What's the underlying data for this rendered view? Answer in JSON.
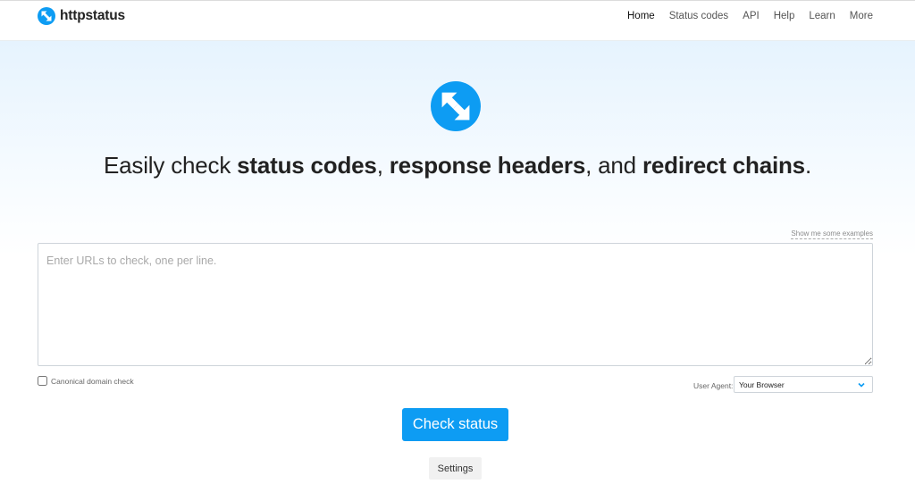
{
  "brand": {
    "name": "httpstatus",
    "logo_icon": "httpstatus-arrows-icon",
    "accent": "#0d9cf3"
  },
  "nav": {
    "items": [
      {
        "label": "Home",
        "active": true
      },
      {
        "label": "Status codes"
      },
      {
        "label": "API"
      },
      {
        "label": "Help"
      },
      {
        "label": "Learn"
      },
      {
        "label": "More"
      }
    ]
  },
  "hero": {
    "headline_prefix": "Easily check ",
    "headline_bold1": "status codes",
    "headline_sep1": ", ",
    "headline_bold2": "response headers",
    "headline_sep2": ", and ",
    "headline_bold3": "redirect chains",
    "headline_suffix": "."
  },
  "form": {
    "examples_link": "Show me some examples",
    "url_placeholder": "Enter URLs to check, one per line.",
    "url_value": "",
    "canonical_label": "Canonical domain check",
    "canonical_checked": false,
    "user_agent_label": "User Agent:",
    "user_agent_value": "Your Browser",
    "check_button": "Check status",
    "settings_button": "Settings"
  }
}
